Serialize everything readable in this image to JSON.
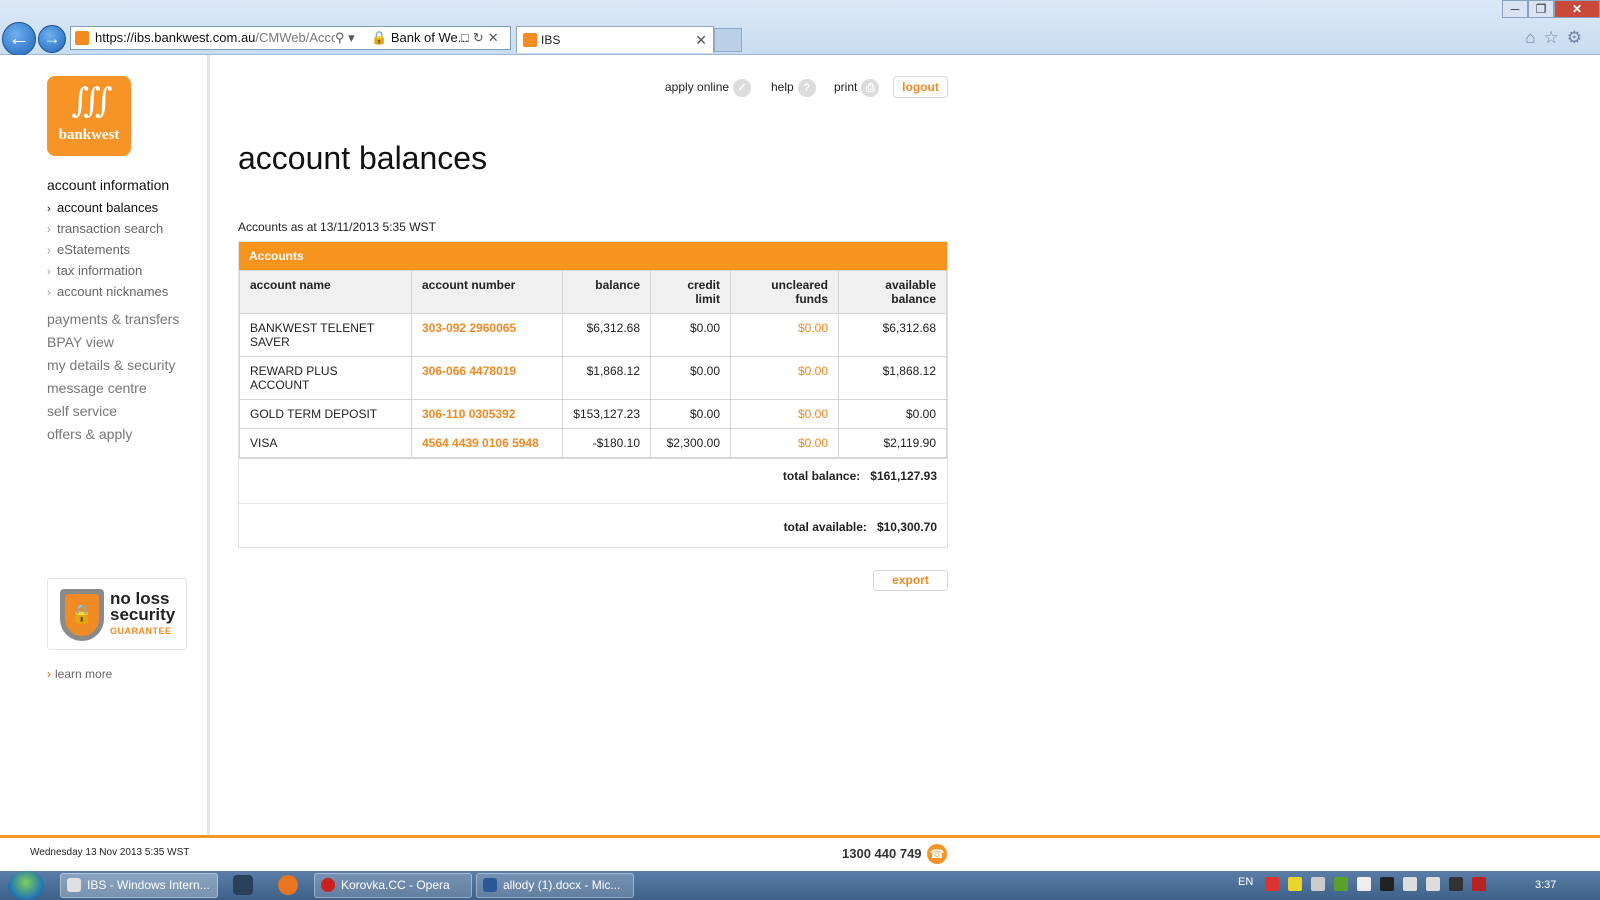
{
  "browser": {
    "url_prefix": "https://ibs.",
    "url_domain": "bankwest.com.au",
    "url_path": "/CMWeb/Acco",
    "site_label": "Bank of We...",
    "tab_title": "IBS",
    "back_icon": "back-arrow-icon",
    "forward_icon": "forward-arrow-icon"
  },
  "sidebar": {
    "logo_text": "bankwest",
    "section_title": "account information",
    "sub_items": [
      {
        "label": "account balances",
        "active": true
      },
      {
        "label": "transaction search"
      },
      {
        "label": "eStatements"
      },
      {
        "label": "tax information"
      },
      {
        "label": "account nicknames"
      }
    ],
    "main_items": [
      {
        "label": "payments & transfers"
      },
      {
        "label": "BPAY view"
      },
      {
        "label": "my details & security"
      },
      {
        "label": "message centre"
      },
      {
        "label": "self service"
      },
      {
        "label": "offers & apply"
      }
    ],
    "guarantee": {
      "line1": "no loss",
      "line2": "security",
      "line3": "GUARANTEE"
    },
    "learn_more": "learn more"
  },
  "header": {
    "apply_online": "apply online",
    "help": "help",
    "help_icon_text": "?",
    "print": "print",
    "logout": "logout"
  },
  "main": {
    "title": "account balances",
    "as_at": "Accounts as at 13/11/2013 5:35 WST",
    "panel_title": "Accounts",
    "columns": {
      "name": "account name",
      "number": "account number",
      "balance": "balance",
      "credit_1": "credit",
      "credit_2": "limit",
      "uncleared_1": "uncleared",
      "uncleared_2": "funds",
      "available_1": "available",
      "available_2": "balance"
    },
    "rows": [
      {
        "name_1": "BANKWEST TELENET",
        "name_2": "SAVER",
        "number": "303-092 2960065",
        "balance": "$6,312.68",
        "credit_limit": "$0.00",
        "uncleared": "$0.00",
        "available": "$6,312.68"
      },
      {
        "name_1": "REWARD PLUS",
        "name_2": "ACCOUNT",
        "number": "306-066 4478019",
        "balance": "$1,868.12",
        "credit_limit": "$0.00",
        "uncleared": "$0.00",
        "available": "$1,868.12"
      },
      {
        "name_1": "GOLD TERM DEPOSIT",
        "name_2": "",
        "number": "306-110 0305392",
        "balance": "$153,127.23",
        "credit_limit": "$0.00",
        "uncleared": "$0.00",
        "available": "$0.00"
      },
      {
        "name_1": "VISA",
        "name_2": "",
        "number": "4564 4439 0106 5948",
        "balance": "-$180.10",
        "credit_limit": "$2,300.00",
        "uncleared": "$0.00",
        "available": "$2,119.90"
      }
    ],
    "total_balance_label": "total balance:",
    "total_balance": "$161,127.93",
    "total_available_label": "total available:",
    "total_available": "$10,300.70",
    "export": "export"
  },
  "footer": {
    "date": "Wednesday 13 Nov 2013 5:35 WST",
    "phone": "1300 440 749"
  },
  "taskbar": {
    "items": [
      {
        "label": "IBS - Windows Intern..."
      },
      {
        "label": "Korovka.CC - Opera"
      },
      {
        "label": "allody (1).docx - Mic..."
      }
    ],
    "lang": "EN",
    "time": "3:37"
  },
  "colors": {
    "brand": "#f7941e",
    "link": "#f08a24"
  }
}
